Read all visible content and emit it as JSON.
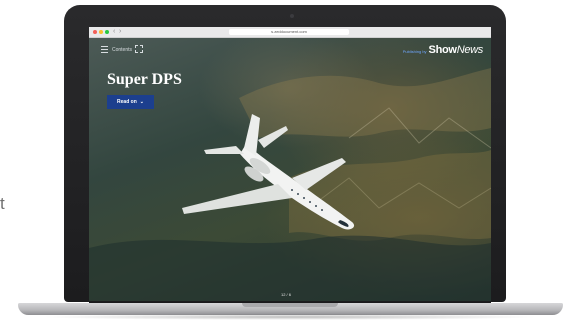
{
  "side_text": "t",
  "browser": {
    "url": "s.zeddocument.com",
    "back_glyph": "‹",
    "forward_glyph": "›"
  },
  "page": {
    "menu_label": "Contents",
    "brand": {
      "prefix": "Publishing by",
      "show": "Show",
      "news": "News"
    },
    "headline": "Super DPS",
    "read_button": "Read on",
    "pager": "12 / 6"
  },
  "colors": {
    "button_bg": "#1c3f8e",
    "brand_prefix": "#6fa7ff"
  },
  "icons": [
    "hamburger-menu-icon",
    "expand-icon",
    "chevron-down-icon"
  ]
}
